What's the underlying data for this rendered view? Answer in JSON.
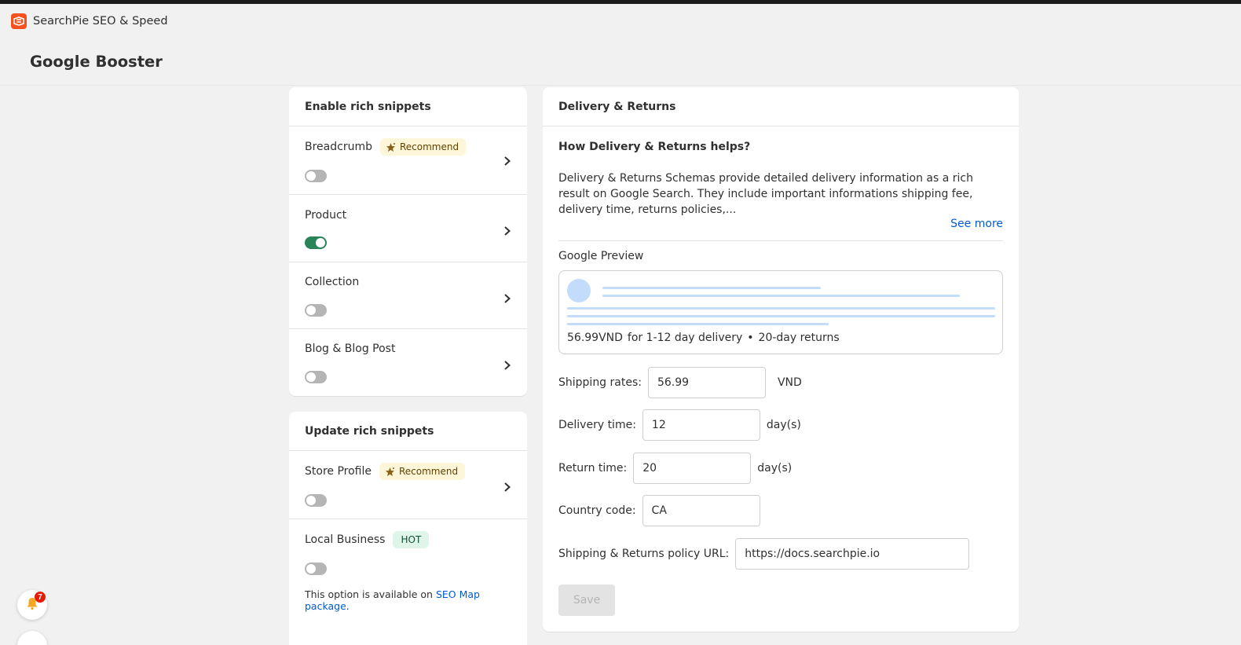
{
  "app": {
    "name": "SearchPie SEO & Speed",
    "accent": "#f4511e"
  },
  "page": {
    "title": "Google Booster"
  },
  "enable_card": {
    "title": "Enable rich snippets",
    "items": [
      {
        "label": "Breadcrumb",
        "badge": "Recommend",
        "enabled": false
      },
      {
        "label": "Product",
        "badge": "",
        "enabled": true
      },
      {
        "label": "Collection",
        "badge": "",
        "enabled": false
      },
      {
        "label": "Blog & Blog Post",
        "badge": "",
        "enabled": false
      }
    ]
  },
  "update_card": {
    "title": "Update rich snippets",
    "items": [
      {
        "label": "Store Profile",
        "badge": "Recommend",
        "enabled": false
      },
      {
        "label": "Local Business",
        "badge": "HOT",
        "enabled": false
      }
    ],
    "note_prefix": "This option is available on",
    "note_link": "SEO Map package",
    "note_suffix": "."
  },
  "delivery_card": {
    "title": "Delivery & Returns",
    "heading": "How Delivery & Returns helps?",
    "description": "Delivery & Returns Schemas provide detailed delivery information as a rich result on Google Search. They include important informations shipping fee, delivery time, returns policies,...",
    "see_more": "See more",
    "preview_label": "Google Preview",
    "preview": {
      "price": "56.99VND",
      "delivery": "for 1-12 day delivery",
      "separator": "•",
      "returns": "20-day returns"
    },
    "fields": {
      "shipping_label": "Shipping rates:",
      "shipping_value": "56.99",
      "shipping_unit": "VND",
      "delivery_label": "Delivery time:",
      "delivery_value": "12",
      "delivery_unit": "day(s)",
      "return_label": "Return time:",
      "return_value": "20",
      "return_unit": "day(s)",
      "country_label": "Country code:",
      "country_value": "CA",
      "policy_label": "Shipping & Returns policy URL:",
      "policy_value": "https://docs.searchpie.io"
    },
    "save_label": "Save"
  },
  "notifications": {
    "count": "7"
  }
}
